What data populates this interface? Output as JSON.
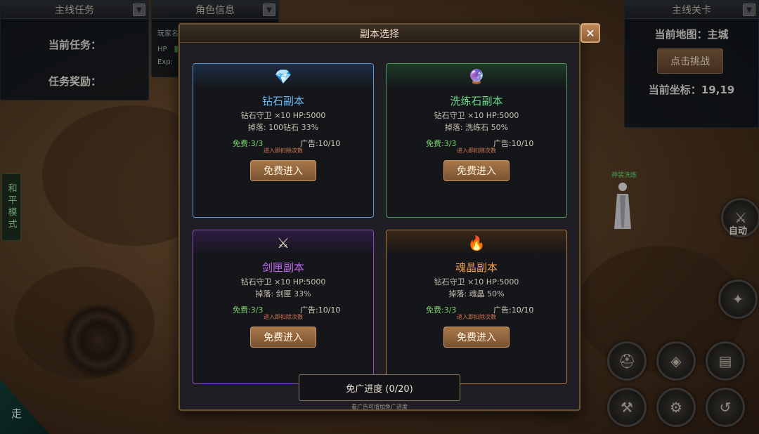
{
  "hud": {
    "quest_panel": {
      "title": "主线任务",
      "current_label": "当前任务：",
      "reward_label": "任务奖励："
    },
    "role_panel": {
      "title": "角色信息",
      "player_label": "玩家名",
      "hp_label": "HP",
      "exp_label": "Exp:"
    },
    "stage_panel": {
      "title": "主线关卡",
      "map_line": "当前地图：主城",
      "challenge_label": "点击挑战",
      "coord_line": "当前坐标：19,19"
    },
    "peace_mode": "和平模式",
    "walk_label": "走",
    "auto_label": "自动",
    "npc_name": "神装洗炼"
  },
  "modal": {
    "title": "副本选择",
    "progress_label": "免广进度 (0/20)",
    "progress_hint": "看广告可增加免广进度",
    "dungeons": [
      {
        "name": "钻石副本",
        "icon": "diamond-icon",
        "glyph": "💎",
        "guard_line": "钻石守卫 ×10  HP:5000",
        "drop_line": "掉落: 100钻石 33%",
        "free": "免费:3/3",
        "ad": "广告:10/10",
        "note": "进入即扣除次数",
        "button": "免费进入",
        "color": "#5a9ad8",
        "band": "#1c2e44",
        "title_color": "#6ab8f0"
      },
      {
        "name": "洗练石副本",
        "icon": "crystal-ball-icon",
        "glyph": "🔮",
        "guard_line": "钻石守卫 ×10  HP:5000",
        "drop_line": "掉落: 洗练石 50%",
        "free": "免费:3/3",
        "ad": "广告:10/10",
        "note": "进入即扣除次数",
        "button": "免费进入",
        "color": "#4a9a5a",
        "band": "#1c3a26",
        "title_color": "#6ad88a"
      },
      {
        "name": "剑匣副本",
        "icon": "crossed-swords-icon",
        "glyph": "⚔",
        "guard_line": "钻石守卫 ×10  HP:5000",
        "drop_line": "掉落: 剑匣 33%",
        "free": "免费:3/3",
        "ad": "广告:10/10",
        "note": "进入即扣除次数",
        "button": "免费进入",
        "color": "#8a4ac8",
        "band": "#2e1c44",
        "title_color": "#c06af0"
      },
      {
        "name": "魂晶副本",
        "icon": "fire-icon",
        "glyph": "🔥",
        "guard_line": "钻石守卫 ×10  HP:5000",
        "drop_line": "掉落: 魂晶 50%",
        "free": "免费:3/3",
        "ad": "广告:10/10",
        "note": "进入即扣除次数",
        "button": "免费进入",
        "color": "#b8783a",
        "band": "#3a2614",
        "title_color": "#f0a050"
      }
    ]
  }
}
